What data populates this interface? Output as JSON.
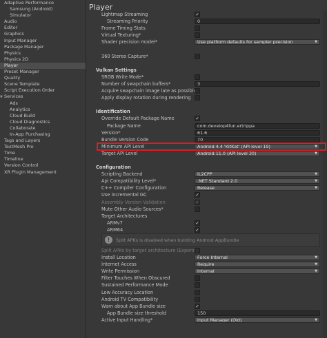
{
  "sidebar": {
    "items": [
      {
        "label": "Adaptive Performance",
        "level": 0
      },
      {
        "label": "Samsung (Android)",
        "level": 1
      },
      {
        "label": "Simulator",
        "level": 1
      },
      {
        "label": "Audio",
        "level": 0
      },
      {
        "label": "Editor",
        "level": 0
      },
      {
        "label": "Graphics",
        "level": 0
      },
      {
        "label": "Input Manager",
        "level": 0
      },
      {
        "label": "Package Manager",
        "level": 0
      },
      {
        "label": "Physics",
        "level": 0
      },
      {
        "label": "Physics 2D",
        "level": 0
      },
      {
        "label": "Player",
        "level": 0,
        "selected": true
      },
      {
        "label": "Preset Manager",
        "level": 0
      },
      {
        "label": "Quality",
        "level": 0
      },
      {
        "label": "Scene Template",
        "level": 0
      },
      {
        "label": "Script Execution Order",
        "level": 0
      },
      {
        "label": "Services",
        "level": 0,
        "fold": true
      },
      {
        "label": "Ads",
        "level": 1
      },
      {
        "label": "Analytics",
        "level": 1
      },
      {
        "label": "Cloud Build",
        "level": 1
      },
      {
        "label": "Cloud Diagnostics",
        "level": 1
      },
      {
        "label": "Collaborate",
        "level": 1
      },
      {
        "label": "In-App Purchasing",
        "level": 1
      },
      {
        "label": "Tags and Layers",
        "level": 0
      },
      {
        "label": "TextMesh Pro",
        "level": 0
      },
      {
        "label": "Time",
        "level": 0
      },
      {
        "label": "Timeline",
        "level": 0
      },
      {
        "label": "Version Control",
        "level": 0
      },
      {
        "label": "XR Plugin Management",
        "level": 0
      }
    ]
  },
  "panel": {
    "title": "Player",
    "rows": [
      {
        "label": "Lightmap Streaming",
        "type": "check",
        "value": "✓"
      },
      {
        "label": "Streaming Priority",
        "type": "field",
        "value": "0",
        "indent": true
      },
      {
        "label": "Frame Timing Stats",
        "type": "check",
        "value": ""
      },
      {
        "label": "Virtual Texturing*",
        "type": "check",
        "value": ""
      },
      {
        "label": "Shader precision model*",
        "type": "dropdown",
        "value": "Use platform defaults for sampler precision"
      },
      {
        "label": "",
        "type": "spacer"
      },
      {
        "label": "360 Stereo Capture*",
        "type": "check",
        "value": ""
      },
      {
        "label": "",
        "type": "spacer"
      },
      {
        "label": "Vulkan Settings",
        "type": "header"
      },
      {
        "label": "SRGB Write Mode*",
        "type": "check",
        "value": ""
      },
      {
        "label": "Number of swapchain buffers*",
        "type": "field",
        "value": "3"
      },
      {
        "label": "Acquire swapchain image late as possible",
        "type": "check",
        "value": ""
      },
      {
        "label": "Apply display rotation during rendering",
        "type": "check",
        "value": ""
      },
      {
        "label": "",
        "type": "spacer"
      },
      {
        "label": "Identification",
        "type": "header"
      },
      {
        "label": "Override Default Package Name",
        "type": "check",
        "value": "✓"
      },
      {
        "label": "Package Name",
        "type": "field",
        "value": "com.develop4fun.ertrippa",
        "indent": true
      },
      {
        "label": "Version*",
        "type": "field",
        "value": "61.6"
      },
      {
        "label": "Bundle Version Code",
        "type": "field",
        "value": "70"
      },
      {
        "label": "Minimum API Level",
        "type": "dropdown",
        "value": "Android 4.4 'KitKat' (API level 19)",
        "highlight": true
      },
      {
        "label": "Target API Level",
        "type": "dropdown",
        "value": "Android 11.0 (API level 30)"
      },
      {
        "label": "",
        "type": "spacer"
      },
      {
        "label": "Configuration",
        "type": "header"
      },
      {
        "label": "Scripting Backend",
        "type": "dropdown",
        "value": "IL2CPP"
      },
      {
        "label": "Api Compatibility Level*",
        "type": "dropdown",
        "value": ".NET Standard 2.0"
      },
      {
        "label": "C++ Compiler Configuration",
        "type": "dropdown",
        "value": "Release"
      },
      {
        "label": "Use incremental GC",
        "type": "check",
        "value": "✓"
      },
      {
        "label": "Assembly Version Validation",
        "type": "check",
        "value": "✓",
        "disabled": true
      },
      {
        "label": "Mute Other Audio Sources*",
        "type": "check",
        "value": ""
      },
      {
        "label": "Target Architectures",
        "type": "label"
      },
      {
        "label": "ARMv7",
        "type": "check",
        "value": "✓",
        "indent": true
      },
      {
        "label": "ARM64",
        "type": "check",
        "value": "✓",
        "indent": true
      },
      {
        "label": "Split APKs is disabled when building Android AppBundle",
        "type": "info"
      },
      {
        "label": "Split APKs by target architecture (Experim",
        "type": "check",
        "value": "",
        "disabled": true
      },
      {
        "label": "Install Location",
        "type": "dropdown",
        "value": "Force Internal"
      },
      {
        "label": "Internet Access",
        "type": "dropdown",
        "value": "Require"
      },
      {
        "label": "Write Permission",
        "type": "dropdown",
        "value": "Internal"
      },
      {
        "label": "Filter Touches When Obscured",
        "type": "check",
        "value": ""
      },
      {
        "label": "Sustained Performance Mode",
        "type": "check",
        "value": ""
      },
      {
        "label": "Low Accuracy Location",
        "type": "check",
        "value": ""
      },
      {
        "label": "Android TV Compatibility",
        "type": "check",
        "value": ""
      },
      {
        "label": "Warn about App Bundle size",
        "type": "check",
        "value": "✓"
      },
      {
        "label": "App Bundle size threshold",
        "type": "field",
        "value": "150",
        "indent": true
      },
      {
        "label": "Active Input Handling*",
        "type": "dropdown",
        "value": "Input Manager (Old)"
      }
    ]
  }
}
